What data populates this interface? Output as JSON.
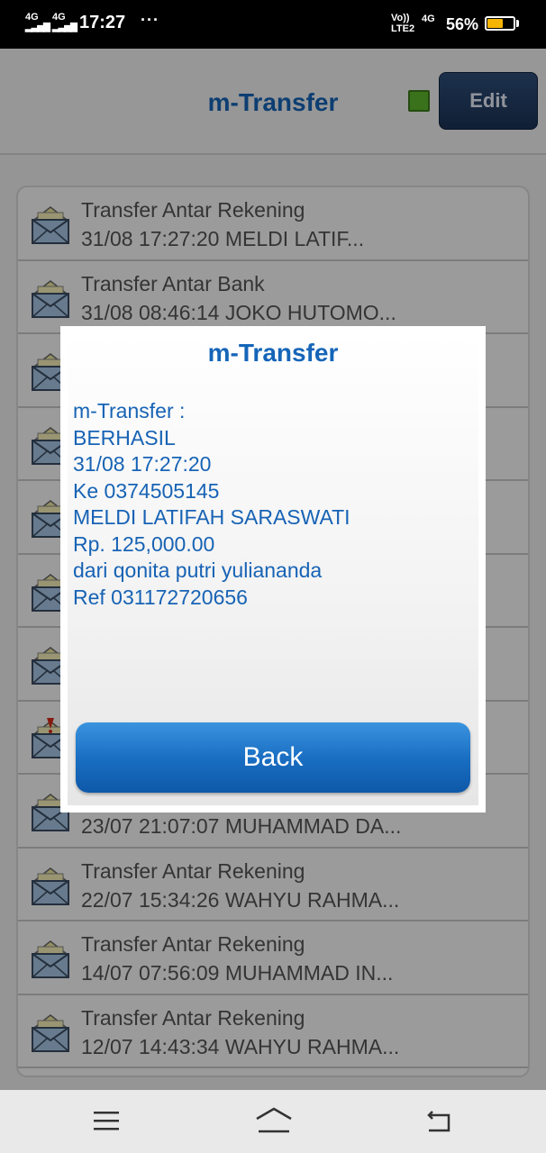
{
  "status_bar": {
    "network1": "4G",
    "network2": "4G",
    "time": "17:27",
    "more": "···",
    "volte": "Vo))",
    "lte": "LTE2",
    "net_type": "4G",
    "battery_percent": "56%",
    "battery_level": 0.56,
    "battery_color": "#f5b400"
  },
  "header": {
    "title": "m-Transfer",
    "edit_label": "Edit",
    "status_color": "#5cb82a"
  },
  "list": {
    "items": [
      {
        "title": "Transfer Antar Rekening",
        "subtitle": "31/08 17:27:20 MELDI LATIF...",
        "icon": "envelope-icon"
      },
      {
        "title": "Transfer Antar Bank",
        "subtitle": "31/08 08:46:14 JOKO HUTOMO...",
        "icon": "envelope-icon"
      },
      {
        "title": "",
        "subtitle": "",
        "icon": "envelope-icon"
      },
      {
        "title": "",
        "subtitle": "",
        "icon": "envelope-icon"
      },
      {
        "title": "",
        "subtitle": "",
        "icon": "envelope-icon"
      },
      {
        "title": "",
        "subtitle": "",
        "icon": "envelope-icon"
      },
      {
        "title": "",
        "subtitle": "",
        "icon": "envelope-icon"
      },
      {
        "title": "",
        "subtitle": "",
        "icon": "envelope-alert-icon"
      },
      {
        "title": "",
        "subtitle": "23/07 21:07:07 MUHAMMAD DA...",
        "icon": "envelope-icon"
      },
      {
        "title": "Transfer Antar Rekening",
        "subtitle": "22/07 15:34:26 WAHYU RAHMA...",
        "icon": "envelope-icon"
      },
      {
        "title": "Transfer Antar Rekening",
        "subtitle": "14/07 07:56:09 MUHAMMAD IN...",
        "icon": "envelope-icon"
      },
      {
        "title": "Transfer Antar Rekening",
        "subtitle": "12/07 14:43:34 WAHYU RAHMA...",
        "icon": "envelope-icon"
      }
    ]
  },
  "dialog": {
    "title": "m-Transfer",
    "lines": [
      "m-Transfer :",
      "BERHASIL",
      "31/08 17:27:20",
      "Ke 0374505145",
      "MELDI LATIFAH SARASWATI",
      "Rp. 125,000.00",
      "dari qonita putri yuliananda",
      "Ref 031172720656"
    ],
    "back_label": "Back"
  },
  "navbar": {
    "menu_icon": "menu-icon",
    "home_icon": "home-icon",
    "back_icon": "back-icon"
  },
  "colors": {
    "accent": "#1565b8",
    "button_blue": "#1a6fc3"
  }
}
